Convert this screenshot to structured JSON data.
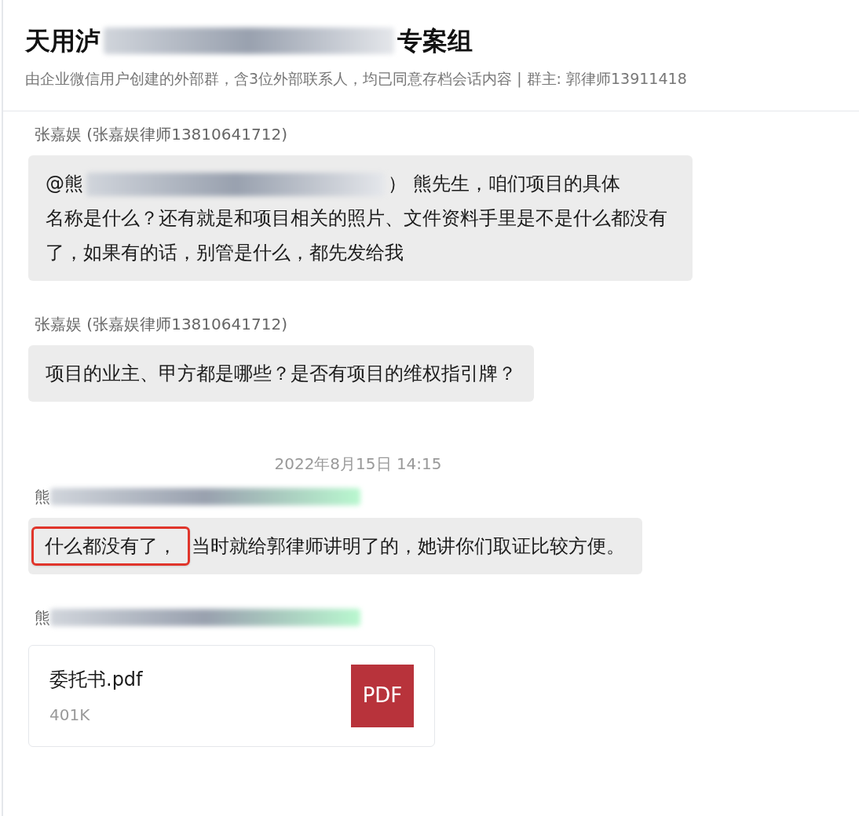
{
  "header": {
    "title": [
      {
        "kind": "text",
        "text": "天用泸"
      },
      {
        "kind": "redacted"
      },
      {
        "kind": "text",
        "text": "专案组"
      }
    ],
    "subtitle": "由企业微信用户创建的外部群，含3位外部联系人，均已同意存档会话内容 | 群主: 郭律师13911418"
  },
  "messages": [
    {
      "kind": "text",
      "sender": [
        {
          "kind": "text",
          "text": "张嘉娱 (张嘉娱律师13810641712)"
        }
      ],
      "body": [
        {
          "kind": "text",
          "text": "@熊"
        },
        {
          "kind": "redacted"
        },
        {
          "kind": "text",
          "text": "） 熊先生，咱们项目的具体"
        },
        {
          "kind": "break"
        },
        {
          "kind": "text",
          "text": "名称是什么？还有就是和项目相关的照片、文件资料手里是不是什么都没有了，如果有的话，别管是什么，都先发给我"
        }
      ]
    },
    {
      "kind": "text",
      "sender": [
        {
          "kind": "text",
          "text": "张嘉娱 (张嘉娱律师13810641712)"
        }
      ],
      "body": [
        {
          "kind": "text",
          "text": "项目的业主、甲方都是哪些？是否有项目的维权指引牌？"
        }
      ]
    },
    {
      "kind": "time",
      "text": "2022年8月15日 14:15"
    },
    {
      "kind": "text",
      "sender": [
        {
          "kind": "text",
          "text": "熊"
        },
        {
          "kind": "redacted"
        }
      ],
      "body": [
        {
          "kind": "highlighted",
          "text": "什么都没有了，"
        },
        {
          "kind": "text",
          "text": "当时就给郭律师讲明了的，她讲你们取证比较方便。"
        }
      ]
    },
    {
      "kind": "file",
      "sender": [
        {
          "kind": "text",
          "text": "熊"
        },
        {
          "kind": "redacted"
        }
      ],
      "file": {
        "name": "委托书.pdf",
        "size": "401K",
        "badge": "PDF"
      }
    }
  ]
}
